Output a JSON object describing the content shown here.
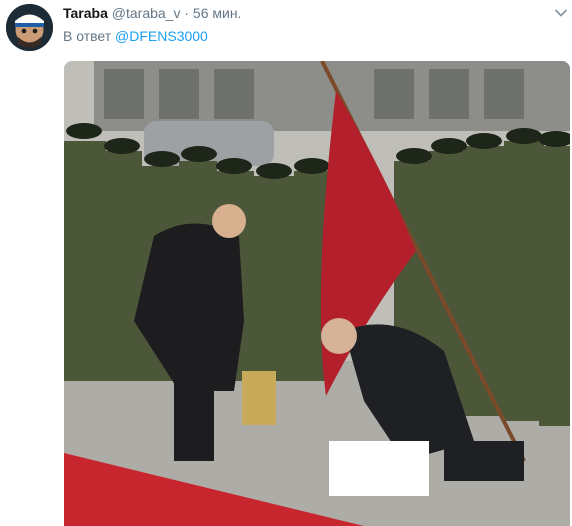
{
  "tweet": {
    "author_name": "Taraba",
    "author_handle": "@taraba_v",
    "separator": "·",
    "time": "56 мин.",
    "reply_prefix": "В ответ",
    "reply_to": "@DFENS3000"
  },
  "icons": {
    "avatar": "user-avatar",
    "caret": "chevron-down-icon"
  },
  "colors": {
    "link": "#1da1f2",
    "secondary_text": "#657786",
    "primary_text": "#14171a",
    "carpet": "#c8262f",
    "banner": "#b31f2a"
  }
}
